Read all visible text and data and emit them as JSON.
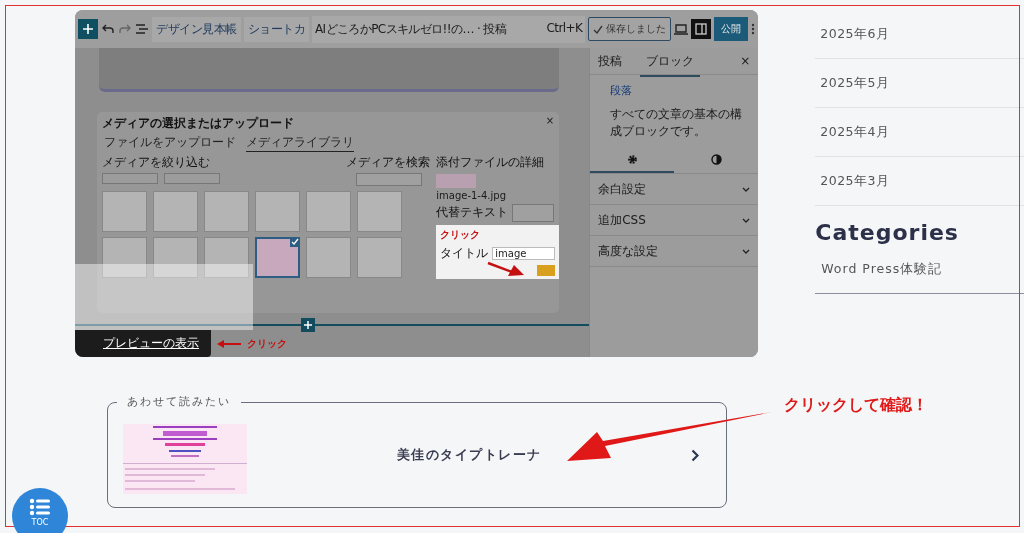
{
  "editor_screenshot": {
    "toolbar": {
      "design_button": "デザイン見本帳",
      "shortcut_button": "ショートカ",
      "document_title": "AIどころかPCスキルゼロ!!の… · 投稿",
      "shortcut_key": "Ctrl+K",
      "save_button": "保存しました",
      "publish_button": "公開"
    },
    "sidebar": {
      "tabs": [
        {
          "label": "投稿",
          "selected": false
        },
        {
          "label": "ブロック",
          "selected": true
        }
      ],
      "close": "×",
      "block_name": "段落",
      "block_description": "すべての文章の基本の構成ブロックです。",
      "panels": [
        "余白設定",
        "追加CSS",
        "高度な設定"
      ]
    },
    "media_dialog": {
      "title": "メディアの選択またはアップロード",
      "close": "×",
      "tabs": [
        {
          "label": "ファイルをアップロード",
          "selected": false
        },
        {
          "label": "メディアライブラリ",
          "selected": true
        }
      ],
      "filter_label": "メディアを絞り込む",
      "search_label": "メディアを検索",
      "details_heading": "添付ファイルの詳細",
      "file_name": "image-1-4.jpg",
      "alt_label": "代替テキスト",
      "annotation": "クリック",
      "title_label": "タイトル",
      "title_value": "image",
      "thumbnails": [
        {
          "selected": false
        },
        {
          "selected": false
        },
        {
          "selected": false
        },
        {
          "selected": false
        },
        {
          "selected": false
        },
        {
          "selected": false
        },
        {
          "selected": false
        },
        {
          "selected": false
        },
        {
          "selected": false
        },
        {
          "selected": true
        },
        {
          "selected": false
        },
        {
          "selected": false
        }
      ]
    },
    "preview_tooltip": "プレビューの表示",
    "preview_annotation": "クリック"
  },
  "related": {
    "legend": "あわせて読みたい",
    "title": "美佳のタイプトレーナ"
  },
  "callout": "クリックして確認！",
  "archives": [
    "2025年6月",
    "2025年5月",
    "2025年4月",
    "2025年3月"
  ],
  "categories": {
    "heading": "Categories",
    "items": [
      "Word Press体験記"
    ]
  },
  "toc_button": "TOC"
}
